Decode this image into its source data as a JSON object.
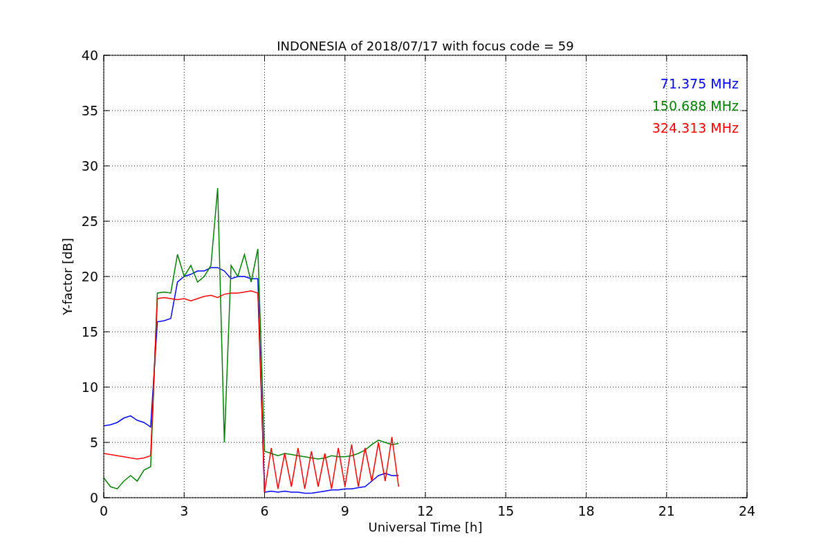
{
  "chart_data": {
    "type": "line",
    "title": "INDONESIA of 2018/07/17 with focus code = 59",
    "xlabel": "Universal Time [h]",
    "ylabel": "Y-factor [dB]",
    "x": [
      0,
      0.25,
      0.5,
      0.75,
      1,
      1.25,
      1.5,
      1.75,
      2,
      2.25,
      2.5,
      2.75,
      3,
      3.25,
      3.5,
      3.75,
      4,
      4.25,
      4.5,
      4.75,
      5,
      5.25,
      5.5,
      5.75,
      6,
      6.25,
      6.5,
      6.75,
      7,
      7.25,
      7.5,
      7.75,
      8,
      8.25,
      8.5,
      8.75,
      9,
      9.25,
      9.5,
      9.75,
      10,
      10.25,
      10.5,
      10.75,
      11
    ],
    "series": [
      {
        "name": "71.375 MHz",
        "color": "#0000ff",
        "values": [
          6.5,
          6.6,
          6.8,
          7.2,
          7.4,
          7.0,
          6.8,
          6.4,
          15.9,
          16.0,
          16.2,
          19.5,
          20.0,
          20.2,
          20.5,
          20.5,
          20.8,
          20.8,
          20.5,
          19.8,
          20.0,
          20.0,
          19.8,
          19.8,
          0.5,
          0.6,
          0.5,
          0.6,
          0.5,
          0.5,
          0.4,
          0.4,
          0.5,
          0.6,
          0.7,
          0.7,
          0.8,
          0.8,
          0.9,
          1.0,
          1.5,
          2.0,
          2.2,
          2.0,
          2.0
        ]
      },
      {
        "name": "150.688 MHz",
        "color": "#008000",
        "values": [
          1.8,
          1.0,
          0.8,
          1.5,
          2.0,
          1.5,
          2.5,
          2.8,
          18.5,
          18.6,
          18.5,
          22.0,
          20.0,
          21.0,
          19.5,
          20.0,
          21.0,
          28.0,
          5.0,
          21.0,
          20.0,
          22.0,
          19.5,
          22.5,
          4.2,
          4.0,
          3.8,
          4.0,
          3.9,
          3.8,
          3.7,
          3.6,
          3.5,
          3.6,
          3.8,
          3.7,
          3.7,
          3.8,
          4.0,
          4.3,
          4.8,
          5.2,
          5.0,
          4.8,
          4.9
        ]
      },
      {
        "name": "324.313 MHz",
        "color": "#ff0000",
        "values": [
          4.0,
          3.9,
          3.8,
          3.7,
          3.6,
          3.5,
          3.6,
          3.8,
          18.0,
          18.1,
          18.0,
          17.9,
          18.0,
          17.8,
          18.0,
          18.2,
          18.3,
          18.1,
          18.4,
          18.5,
          18.5,
          18.6,
          18.7,
          18.5,
          0.5,
          4.5,
          0.8,
          4.0,
          1.0,
          4.5,
          0.8,
          4.2,
          1.0,
          4.0,
          0.8,
          4.5,
          1.0,
          4.8,
          1.0,
          4.5,
          1.5,
          5.0,
          1.5,
          5.5,
          1.0
        ]
      }
    ],
    "xlim": [
      0,
      24
    ],
    "ylim": [
      0,
      40
    ],
    "xticks": [
      0,
      3,
      6,
      9,
      12,
      15,
      18,
      21,
      24
    ],
    "yticks": [
      0,
      5,
      10,
      15,
      20,
      25,
      30,
      35,
      40
    ],
    "grid": true
  }
}
